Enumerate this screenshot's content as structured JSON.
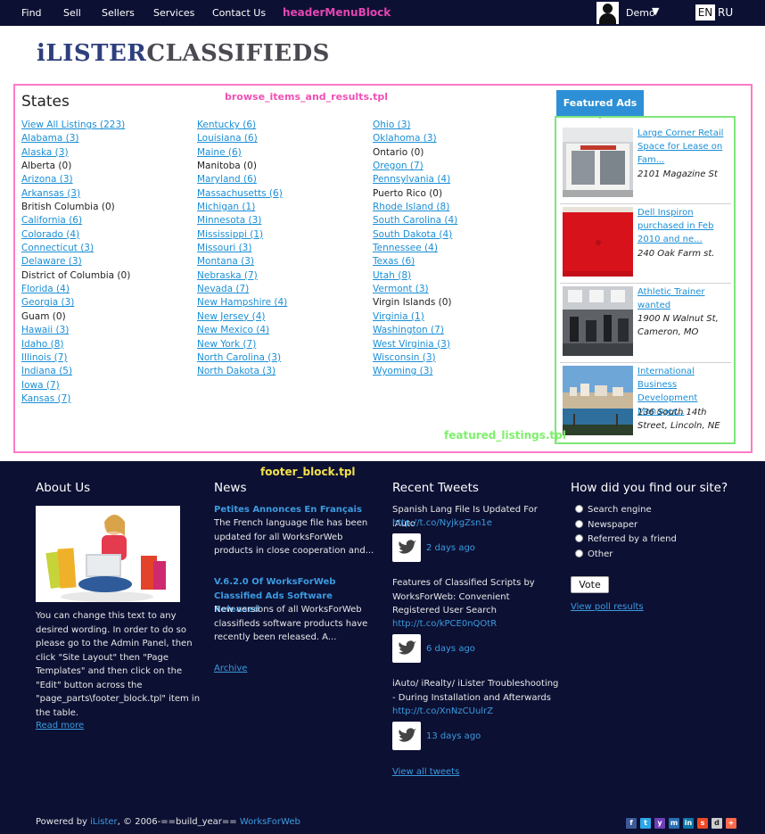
{
  "header": {
    "nav": [
      "Find",
      "Sell",
      "Sellers",
      "Services",
      "Contact Us"
    ],
    "block_label": "headerMenuBlock",
    "user_name": "Demo",
    "user_caret": "▼",
    "languages": [
      "EN",
      "RU"
    ]
  },
  "logo": {
    "part1": "iLISTER",
    "part2": "CLASSIFIEDS"
  },
  "browse": {
    "title": "States",
    "block_label": "browse_items_and_results.tpl",
    "columns": [
      [
        {
          "text": "View All Listings (223)",
          "link": true
        },
        {
          "text": "Alabama (3)",
          "link": true
        },
        {
          "text": "Alaska (3)",
          "link": true
        },
        {
          "text": "Alberta (0)",
          "link": false
        },
        {
          "text": "Arizona (3)",
          "link": true
        },
        {
          "text": "Arkansas (3)",
          "link": true
        },
        {
          "text": "British Columbia (0)",
          "link": false
        },
        {
          "text": "California (6)",
          "link": true
        },
        {
          "text": "Colorado (4)",
          "link": true
        },
        {
          "text": "Connecticut (3)",
          "link": true
        },
        {
          "text": "Delaware (3)",
          "link": true
        },
        {
          "text": "District of Columbia (0)",
          "link": false
        },
        {
          "text": "Florida (4)",
          "link": true
        },
        {
          "text": "Georgia (3)",
          "link": true
        },
        {
          "text": "Guam (0)",
          "link": false
        },
        {
          "text": "Hawaii (3)",
          "link": true
        },
        {
          "text": "Idaho (8)",
          "link": true
        },
        {
          "text": "Illinois (7)",
          "link": true
        },
        {
          "text": "Indiana (5)",
          "link": true
        },
        {
          "text": "Iowa (7)",
          "link": true
        },
        {
          "text": "Kansas (7)",
          "link": true
        }
      ],
      [
        {
          "text": "Kentucky (6)",
          "link": true
        },
        {
          "text": "Louisiana (6)",
          "link": true
        },
        {
          "text": "Maine (6)",
          "link": true
        },
        {
          "text": "Manitoba (0)",
          "link": false
        },
        {
          "text": "Maryland (6)",
          "link": true
        },
        {
          "text": "Massachusetts (6)",
          "link": true
        },
        {
          "text": "Michigan (1)",
          "link": true
        },
        {
          "text": "Minnesota (3)",
          "link": true
        },
        {
          "text": "Mississippi (1)",
          "link": true
        },
        {
          "text": "Missouri (3)",
          "link": true
        },
        {
          "text": "Montana (3)",
          "link": true
        },
        {
          "text": "Nebraska (7)",
          "link": true
        },
        {
          "text": "Nevada (7)",
          "link": true
        },
        {
          "text": "New Hampshire (4)",
          "link": true
        },
        {
          "text": "New Jersey (4)",
          "link": true
        },
        {
          "text": "New Mexico (4)",
          "link": true
        },
        {
          "text": "New York (7)",
          "link": true
        },
        {
          "text": "North Carolina (3)",
          "link": true
        },
        {
          "text": "North Dakota (3)",
          "link": true
        }
      ],
      [
        {
          "text": "Ohio (3)",
          "link": true
        },
        {
          "text": "Oklahoma (3)",
          "link": true
        },
        {
          "text": "Ontario (0)",
          "link": false
        },
        {
          "text": "Oregon (7)",
          "link": true
        },
        {
          "text": "Pennsylvania (4)",
          "link": true
        },
        {
          "text": "Puerto Rico (0)",
          "link": false
        },
        {
          "text": "Rhode Island (8)",
          "link": true
        },
        {
          "text": "South Carolina (4)",
          "link": true
        },
        {
          "text": "South Dakota (4)",
          "link": true
        },
        {
          "text": "Tennessee (4)",
          "link": true
        },
        {
          "text": "Texas (6)",
          "link": true
        },
        {
          "text": "Utah (8)",
          "link": true
        },
        {
          "text": "Vermont (3)",
          "link": true
        },
        {
          "text": "Virgin Islands (0)",
          "link": false
        },
        {
          "text": "Virginia (1)",
          "link": true
        },
        {
          "text": "Washington (7)",
          "link": true
        },
        {
          "text": "West Virginia (3)",
          "link": true
        },
        {
          "text": "Wisconsin (3)",
          "link": true
        },
        {
          "text": "Wyoming (3)",
          "link": true
        }
      ]
    ]
  },
  "featured": {
    "tab_label": "Featured Ads",
    "block_label": "featured_listings.tpl",
    "ads": [
      {
        "title": "Large Corner Retail Space for Lease on Fam...",
        "address": "2101 Magazine St"
      },
      {
        "title": "Dell Inspiron purchased in Feb 2010 and ne...",
        "address": "240 Oak Farm st."
      },
      {
        "title": "Athletic Trainer wanted",
        "address": "1900 N Walnut St, Cameron, MO"
      },
      {
        "title": "International Business Development Manager...",
        "address": "136 South 14th Street, Lincoln, NE"
      }
    ]
  },
  "footer": {
    "block_label": "footer_block.tpl",
    "about": {
      "title": "About Us",
      "text": "You can change this text to any desired wording. In order to do so please go to the Admin Panel, then click \"Site Layout\" then \"Page Templates\" and then click on the \"Edit\" button across the \"page_parts\\footer_block.tpl\" item in the table.",
      "read_more": "Read more"
    },
    "news": {
      "title": "News",
      "items": [
        {
          "title": "Petites Annonces En Français",
          "text": "The French language file has been updated for all WorksForWeb products in close cooperation and..."
        },
        {
          "title": "V.6.2.0 Of WorksForWeb Classified Ads Software Released",
          "text": "New versions of all WorksForWeb classifieds software products have recently been released. A..."
        }
      ],
      "archive": "Archive"
    },
    "tweets": {
      "title": "Recent Tweets",
      "items": [
        {
          "text": "Spanish Lang File Is Updated For iAuto",
          "link": "http://t.co/NyjkgZsn1e",
          "time": "2 days ago"
        },
        {
          "text": "Features of Classified Scripts by WorksForWeb: Convenient Registered User Search",
          "link": "http://t.co/kPCE0nQOtR",
          "time": "6 days ago"
        },
        {
          "text": "iAuto/ iRealty/ iLister Troubleshooting - During Installation and Afterwards",
          "link": "http://t.co/XnNzCUulrZ",
          "time": "13 days ago"
        }
      ],
      "view_all": "View all tweets"
    },
    "poll": {
      "title": "How did you find our site?",
      "options": [
        "Search engine",
        "Newspaper",
        "Referred by a friend",
        "Other"
      ],
      "vote": "Vote",
      "results": "View poll results"
    },
    "powered": {
      "prefix": "Powered by ",
      "ilister": "iLister",
      "middle": ", © 2006-==build_year== ",
      "wfw": "WorksForWeb"
    },
    "share_icons": [
      "facebook-icon",
      "twitter-icon",
      "yahoo-icon",
      "myspace-icon",
      "linkedin-icon",
      "stumbleupon-icon",
      "delicious-icon",
      "addthis-icon"
    ]
  },
  "colors": {
    "header_bg": "#0c1033",
    "link": "#1a8fd6",
    "browse_outline": "#ff7ac8",
    "featured_outline": "#7fe67a",
    "featured_tab": "#2d8fd6"
  }
}
